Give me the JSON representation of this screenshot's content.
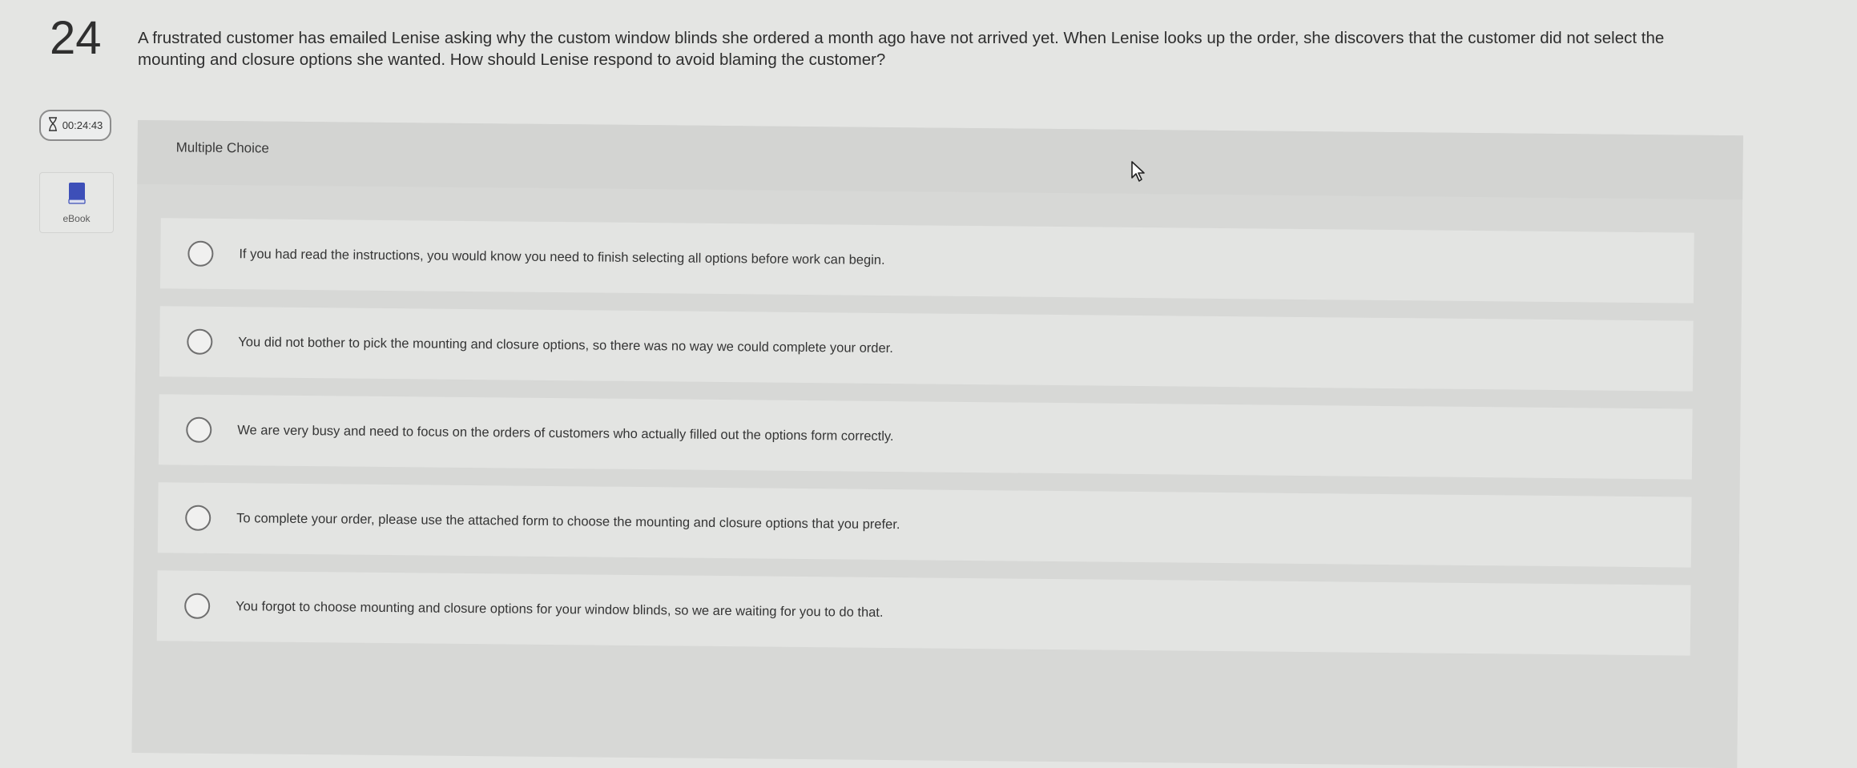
{
  "question": {
    "number": "24",
    "text": "A frustrated customer has emailed Lenise asking why the custom window blinds she ordered a month ago have not arrived yet. When Lenise looks up the order, she discovers that the customer did not select the mounting and closure options she wanted. How should Lenise respond to avoid blaming the customer?"
  },
  "sidebar": {
    "timer": {
      "icon": "hourglass-icon",
      "value": "00:24:43"
    },
    "ebook": {
      "icon": "book-icon",
      "label": "eBook",
      "color": "#3d4fb8"
    }
  },
  "card": {
    "label": "Multiple Choice",
    "choices": [
      "If you had read the instructions, you would know you need to finish selecting all options before work can begin.",
      "You did not bother to pick the mounting and closure options, so there was no way we could complete your order.",
      "We are very busy and need to focus on the orders of customers who actually filled out the options form correctly.",
      "To complete your order, please use the attached form to choose the mounting and closure options that you prefer.",
      "You forgot to choose mounting and closure options for your window blinds, so we are waiting for you to do that."
    ]
  },
  "colors": {
    "background": "#e4e5e3",
    "card": "#d7d8d6",
    "choice": "#e3e4e2"
  }
}
